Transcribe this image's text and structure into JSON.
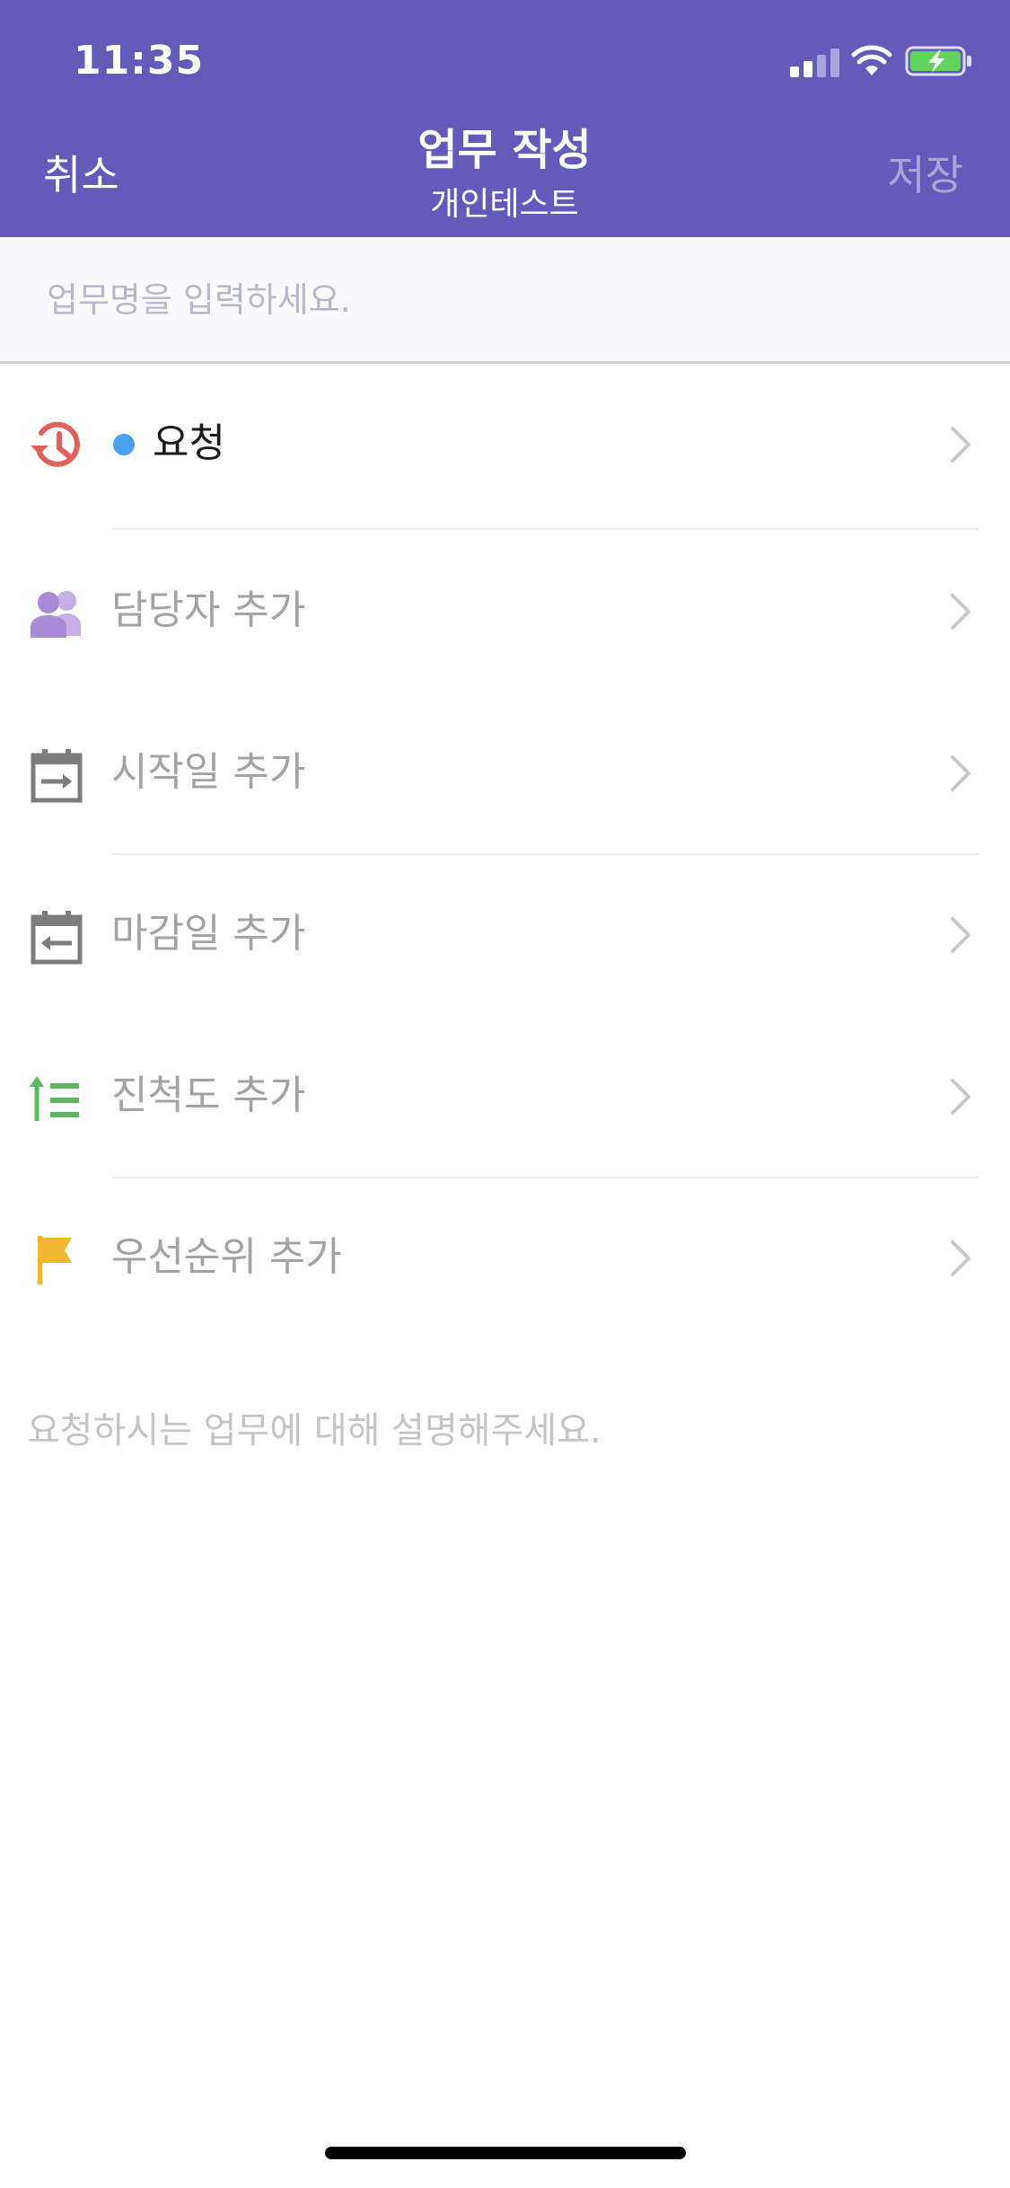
{
  "status_bar": {
    "time": "11:35",
    "icons": [
      "cellular-signal-icon",
      "wifi-icon",
      "battery-charging-icon"
    ]
  },
  "header": {
    "cancel_label": "취소",
    "title": "업무 작성",
    "subtitle": "개인테스트",
    "save_label": "저장",
    "background_color": "#625bb9"
  },
  "task_name": {
    "placeholder": "업무명을 입력하세요.",
    "value": ""
  },
  "rows": [
    {
      "icon": "request-history-icon",
      "label": "요청",
      "status_color": "#4a9ff0",
      "chevron": "chevron-right-icon"
    },
    {
      "icon": "assignee-users-icon",
      "label": "담당자 추가",
      "chevron": "chevron-right-icon"
    },
    {
      "icon": "start-date-calendar-icon",
      "label": "시작일 추가",
      "chevron": "chevron-right-icon"
    },
    {
      "icon": "due-date-calendar-icon",
      "label": "마감일 추가",
      "chevron": "chevron-right-icon"
    },
    {
      "icon": "progress-list-icon",
      "label": "진척도 추가",
      "chevron": "chevron-right-icon"
    },
    {
      "icon": "priority-flag-icon",
      "label": "우선순위 추가",
      "chevron": "chevron-right-icon"
    }
  ],
  "description": {
    "placeholder": "요청하시는 업무에 대해 설명해주세요."
  },
  "colors": {
    "accent": "#625bb9",
    "request_icon": "#e0605a",
    "assignee_icon": "#a98ad6",
    "calendar_icon": "#7c7c7c",
    "progress_icon": "#5cb85c",
    "flag_icon": "#f2b731"
  }
}
